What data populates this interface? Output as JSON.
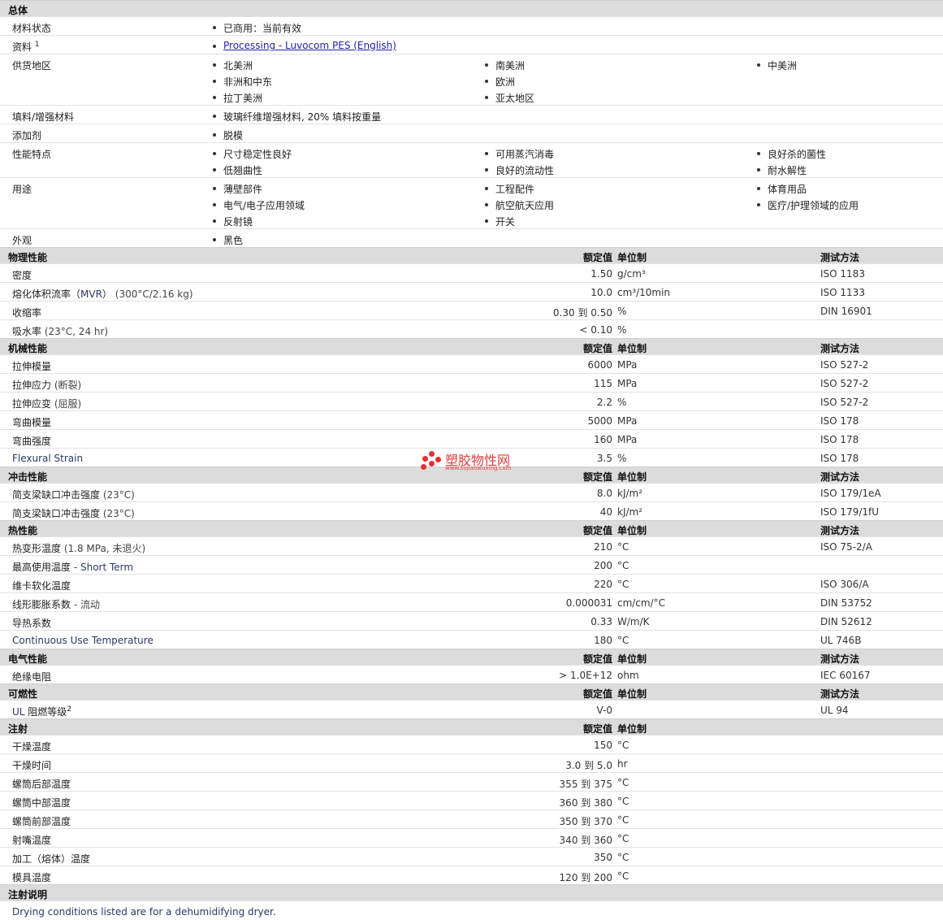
{
  "general": {
    "title": "总体",
    "material_status": {
      "label": "材料状态",
      "value": "已商用：当前有效"
    },
    "docs": {
      "label": "资料",
      "note": "1",
      "link": "Processing - Luvocom PES (English)"
    },
    "regions": {
      "label": "供货地区",
      "items": [
        "北美洲",
        "南美洲",
        "中美洲",
        "非洲和中东",
        "欧洲",
        "拉丁美洲",
        "亚太地区"
      ]
    },
    "filler": {
      "label": "填料/增强材料",
      "value": "玻璃纤维增强材料, 20% 填料按重量"
    },
    "additive": {
      "label": "添加剂",
      "value": "脱模"
    },
    "features": {
      "label": "性能特点",
      "items": [
        "尺寸稳定性良好",
        "可用蒸汽消毒",
        "良好杀的菌性",
        "低翘曲性",
        "良好的流动性",
        "耐水解性"
      ]
    },
    "uses": {
      "label": "用途",
      "items": [
        "薄壁部件",
        "工程配件",
        "体育用品",
        "电气/电子应用领域",
        "航空航天应用",
        "医疗/护理领域的应用",
        "反射镜",
        "开关"
      ]
    },
    "appearance": {
      "label": "外观",
      "value": "黑色"
    }
  },
  "columns": {
    "value": "额定值",
    "unit": "单位制",
    "test": "测试方法"
  },
  "physical": {
    "title": "物理性能",
    "rows": [
      {
        "name": "密度",
        "cond": "",
        "value": "1.50",
        "unit": "g/cm³",
        "test": "ISO 1183"
      },
      {
        "name": "熔化体积流率（",
        "en": "MVR",
        "name2": "）",
        "cond": "(300°C/2.16 kg)",
        "value": "10.0",
        "unit": "cm³/10min",
        "test": "ISO 1133"
      },
      {
        "name": "收缩率",
        "cond": "",
        "value": "0.30 到  0.50",
        "unit": "%",
        "test": "DIN 16901"
      },
      {
        "name": "吸水率",
        "cond": "(23°C, 24 hr)",
        "value": "< 0.10",
        "unit": "%",
        "test": ""
      }
    ]
  },
  "mechanical": {
    "title": "机械性能",
    "rows": [
      {
        "name": "拉伸模量",
        "cond": "",
        "value": "6000",
        "unit": "MPa",
        "test": "ISO 527-2"
      },
      {
        "name": "拉伸应力",
        "cond": "(断裂)",
        "value": "115",
        "unit": "MPa",
        "test": "ISO 527-2"
      },
      {
        "name": "拉伸应变",
        "cond": "(屈服)",
        "value": "2.2",
        "unit": "%",
        "test": "ISO 527-2"
      },
      {
        "name": "弯曲模量",
        "cond": "",
        "value": "5000",
        "unit": "MPa",
        "test": "ISO 178"
      },
      {
        "name": "弯曲强度",
        "cond": "",
        "value": "160",
        "unit": "MPa",
        "test": "ISO 178"
      },
      {
        "en": "Flexural Strain",
        "cond": "",
        "value": "3.5",
        "unit": "%",
        "test": "ISO 178"
      }
    ]
  },
  "impact": {
    "title": "冲击性能",
    "rows": [
      {
        "name": "简支梁缺口冲击强度",
        "cond": "(23°C)",
        "value": "8.0",
        "unit": "kJ/m²",
        "test": "ISO 179/1eA"
      },
      {
        "name": "简支梁缺口冲击强度",
        "cond": "(23°C)",
        "value": "40",
        "unit": "kJ/m²",
        "test": "ISO 179/1fU"
      }
    ]
  },
  "thermal": {
    "title": "热性能",
    "rows": [
      {
        "name": "热变形温度",
        "cond": "(1.8 MPa, 未退火)",
        "value": "210",
        "unit": "°C",
        "test": "ISO 75-2/A"
      },
      {
        "name": "最高使用温度",
        "en": " - Short Term",
        "cond": "",
        "value": "200",
        "unit": "°C",
        "test": ""
      },
      {
        "name": "维卡软化温度",
        "cond": "",
        "value": "220",
        "unit": "°C",
        "test": "ISO 306/A"
      },
      {
        "name": "线形膨胀系数",
        "cond": " - 流动",
        "value": "0.000031",
        "unit": "cm/cm/°C",
        "test": "DIN 53752"
      },
      {
        "name": "导热系数",
        "cond": "",
        "value": "0.33",
        "unit": "W/m/K",
        "test": "DIN 52612"
      },
      {
        "en": "Continuous Use Temperature",
        "cond": "",
        "value": "180",
        "unit": "°C",
        "test": "UL 746B"
      }
    ]
  },
  "electrical": {
    "title": "电气性能",
    "rows": [
      {
        "name": "绝缘电阻",
        "cond": "",
        "value": "> 1.0E+12",
        "unit": "ohm",
        "test": "IEC 60167"
      }
    ]
  },
  "flammability": {
    "title": "可燃性",
    "rows": [
      {
        "en": "UL ",
        "name": "阻燃等级",
        "sup": "2",
        "cond": "",
        "value": "V-0",
        "unit": "",
        "test": "UL 94"
      }
    ]
  },
  "injection": {
    "title": "注射",
    "rows": [
      {
        "name": "干燥温度",
        "cond": "",
        "value": "150",
        "unit": "°C",
        "test": ""
      },
      {
        "name": "干燥时间",
        "cond": "",
        "value": "3.0 到  5.0",
        "unit": "hr",
        "test": ""
      },
      {
        "name": "螺筒后部温度",
        "cond": "",
        "value": "355 到  375",
        "unit": "°C",
        "test": ""
      },
      {
        "name": "螺筒中部温度",
        "cond": "",
        "value": "360 到  380",
        "unit": "°C",
        "test": ""
      },
      {
        "name": "螺筒前部温度",
        "cond": "",
        "value": "350 到  370",
        "unit": "°C",
        "test": ""
      },
      {
        "name": "射嘴温度",
        "cond": "",
        "value": "340 到  360",
        "unit": "°C",
        "test": ""
      },
      {
        "name": "加工（熔体）温度",
        "cond": "",
        "value": "350",
        "unit": "°C",
        "test": ""
      },
      {
        "name": "模具温度",
        "cond": "",
        "value": "120 到  200",
        "unit": "°C",
        "test": ""
      }
    ]
  },
  "injection_notes": {
    "title": "注射说明",
    "text": "Drying conditions listed are for a dehumidifying dryer."
  },
  "watermark": {
    "name": "塑胶物性网",
    "url": "www.sujiaowuxing.com",
    "color": "#e53030"
  }
}
